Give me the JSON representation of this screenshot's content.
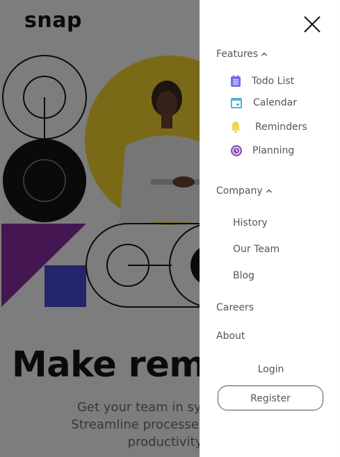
{
  "page": {
    "logo": "snap",
    "headline": "Make remo",
    "subtitle_lines": [
      "Get your team in sync, no ma",
      "Streamline processes, create te",
      "productivity s"
    ]
  },
  "menu": {
    "close_icon": "close-icon",
    "features": {
      "label": "Features",
      "items": [
        {
          "label": "Todo List",
          "icon": "todo-list-icon",
          "color": "#726CEE"
        },
        {
          "label": "Calendar",
          "icon": "calendar-icon",
          "color": "#4BB1DA"
        },
        {
          "label": "Reminders",
          "icon": "bell-icon",
          "color": "#EDD556"
        },
        {
          "label": "Planning",
          "icon": "planning-icon",
          "color": "#8E4CB6"
        }
      ]
    },
    "company": {
      "label": "Company",
      "items": [
        {
          "label": "History"
        },
        {
          "label": "Our Team"
        },
        {
          "label": "Blog"
        }
      ]
    },
    "careers": "Careers",
    "about": "About",
    "login": "Login",
    "register": "Register"
  },
  "colors": {
    "overlay": "rgba(0,0,0,0.5)",
    "text": "#555555",
    "hero_yellow": "#F5D431",
    "hero_purple": "#8B2FA5",
    "hero_blue": "#4B4BD8"
  }
}
